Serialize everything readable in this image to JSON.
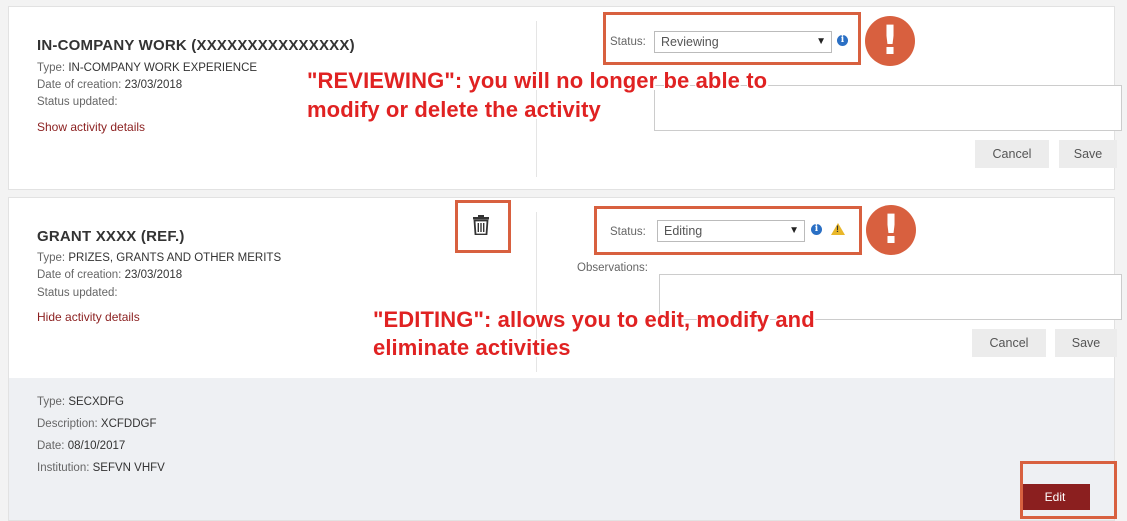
{
  "activity1": {
    "title": "IN-COMPANY WORK (XXXXXXXXXXXXXXX)",
    "type_label": "Type:",
    "type_value": "IN-COMPANY WORK EXPERIENCE",
    "date_label": "Date of creation:",
    "date_value": "23/03/2018",
    "status_updated_label": "Status updated:",
    "details_link": "Show activity details",
    "status_label": "Status:",
    "status_value": "Reviewing",
    "cancel_label": "Cancel",
    "save_label": "Save",
    "annotation_line1": "\"REVIEWING\": you will no longer be able to",
    "annotation_line2": "modify or delete the activity"
  },
  "activity2": {
    "title": "GRANT XXXX (REF.)",
    "type_label": "Type:",
    "type_value": "PRIZES, GRANTS AND OTHER MERITS",
    "date_label": "Date of creation:",
    "date_value": "23/03/2018",
    "status_updated_label": "Status updated:",
    "details_link": "Hide activity details",
    "status_label": "Status:",
    "status_value": "Editing",
    "observations_label": "Observations:",
    "cancel_label": "Cancel",
    "save_label": "Save",
    "annotation_line1": "\"EDITING\": allows you to edit, modify and",
    "annotation_line2": "eliminate activities",
    "details": {
      "type_label": "Type:",
      "type_value": "SECXDFG",
      "description_label": "Description:",
      "description_value": "XCFDDGF",
      "date_label": "Date:",
      "date_value": "08/10/2017",
      "institution_label": "Institution:",
      "institution_value": "SEFVN VHFV",
      "edit_label": "Edit"
    }
  },
  "annotation_color": "#e02222",
  "highlight_color": "#d8603f",
  "accent_color": "#8b1f1f",
  "icons": [
    "info-icon",
    "warning-icon",
    "trash-icon",
    "exclamation-icon"
  ]
}
